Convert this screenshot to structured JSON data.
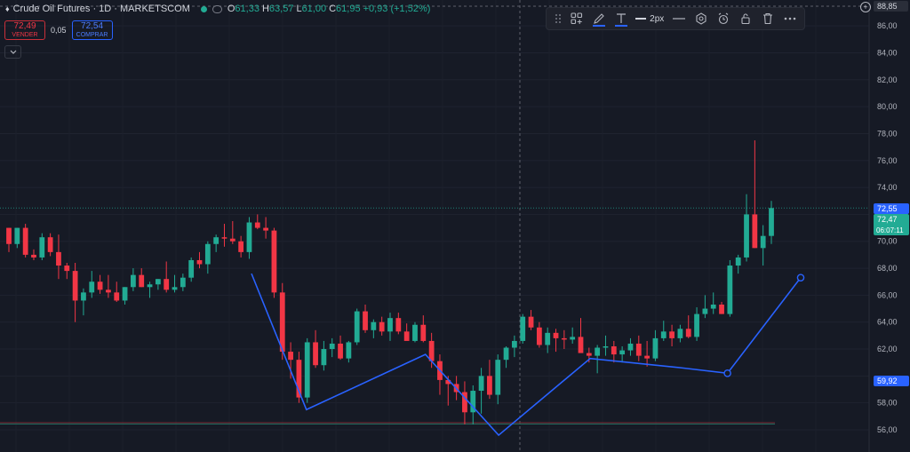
{
  "header": {
    "symbol": "Crude Oil Futures · 1D · MARKETSCOM",
    "ohlc": [
      {
        "label": "O",
        "value": "61,33"
      },
      {
        "label": "H",
        "value": "63,57"
      },
      {
        "label": "L",
        "value": "61,00"
      },
      {
        "label": "C",
        "value": "61,95"
      }
    ],
    "change": "+0,93 (+1,52%)"
  },
  "trade": {
    "sell_price": "72,49",
    "sell_label": "VENDER",
    "spread": "0,05",
    "buy_price": "72,54",
    "buy_label": "COMPRAR"
  },
  "collapse_icon": "chevron-down-icon",
  "toolbar": {
    "icons": [
      "drag-handle-icon",
      "template-icon",
      "pencil-icon",
      "text-icon",
      "line-width-icon",
      "line-style-icon",
      "settings-icon",
      "alert-clock-icon",
      "lock-icon",
      "trash-icon",
      "more-icon"
    ],
    "line_width_label": "2px",
    "accent": "#2962ff"
  },
  "price_axis": {
    "top_label": "88,85",
    "labels": [
      "86,00",
      "84,00",
      "82,00",
      "80,00",
      "78,00",
      "76,00",
      "74,00",
      "70,00",
      "68,00",
      "66,00",
      "64,00",
      "62,00",
      "58,00",
      "56,00"
    ],
    "badge_ask": "72,55",
    "badge_last": "72,47",
    "badge_countdown": "06:07:11",
    "badge_point": "59,92",
    "colors": {
      "up": "#22ab94",
      "down": "#f23645",
      "ask": "#2962ff",
      "line": "#2962ff"
    }
  },
  "chart_data": {
    "type": "candlestick",
    "y_range": [
      55.5,
      89.6
    ],
    "candles": [
      [
        71.0,
        71.0,
        69.2,
        69.8
      ],
      [
        69.8,
        71.0,
        69.5,
        71.0
      ],
      [
        71.0,
        71.3,
        68.8,
        69.0
      ],
      [
        69.0,
        69.4,
        68.6,
        68.8
      ],
      [
        68.8,
        70.6,
        68.6,
        70.3
      ],
      [
        70.3,
        70.6,
        68.9,
        69.2
      ],
      [
        69.2,
        70.5,
        67.2,
        68.2
      ],
      [
        68.2,
        68.4,
        67.2,
        67.8
      ],
      [
        67.8,
        68.4,
        64.0,
        65.6
      ],
      [
        65.6,
        66.5,
        64.5,
        66.2
      ],
      [
        66.2,
        67.8,
        65.8,
        67.0
      ],
      [
        67.0,
        67.5,
        66.1,
        66.4
      ],
      [
        66.4,
        67.5,
        65.8,
        66.2
      ],
      [
        66.2,
        67.0,
        65.5,
        65.6
      ],
      [
        65.6,
        66.6,
        65.3,
        66.6
      ],
      [
        66.6,
        68.0,
        66.3,
        67.5
      ],
      [
        67.5,
        68.0,
        66.6,
        66.6
      ],
      [
        66.6,
        67.0,
        65.8,
        66.8
      ],
      [
        66.8,
        67.2,
        66.4,
        67.2
      ],
      [
        67.2,
        68.5,
        66.2,
        66.4
      ],
      [
        66.4,
        67.5,
        66.2,
        66.6
      ],
      [
        66.6,
        67.6,
        66.3,
        67.3
      ],
      [
        67.3,
        68.8,
        67.0,
        68.6
      ],
      [
        68.6,
        69.2,
        68.0,
        68.3
      ],
      [
        68.3,
        70.0,
        67.6,
        69.8
      ],
      [
        69.8,
        70.5,
        69.2,
        70.3
      ],
      [
        70.3,
        71.3,
        69.6,
        70.2
      ],
      [
        70.2,
        71.5,
        69.8,
        70.0
      ],
      [
        70.0,
        70.4,
        68.8,
        69.2
      ],
      [
        69.2,
        71.8,
        68.7,
        71.4
      ],
      [
        71.4,
        72.0,
        70.9,
        71.0
      ],
      [
        71.0,
        71.8,
        70.2,
        70.8
      ],
      [
        70.8,
        71.0,
        65.8,
        66.2
      ],
      [
        66.2,
        66.9,
        61.2,
        61.8
      ],
      [
        61.8,
        62.5,
        59.8,
        61.2
      ],
      [
        61.2,
        61.8,
        58.0,
        58.4
      ],
      [
        58.4,
        62.8,
        58.0,
        62.5
      ],
      [
        62.5,
        63.4,
        60.6,
        60.8
      ],
      [
        60.8,
        62.6,
        60.4,
        62.0
      ],
      [
        62.0,
        62.8,
        61.4,
        62.4
      ],
      [
        62.4,
        63.0,
        61.2,
        61.3
      ],
      [
        61.3,
        62.6,
        61.0,
        62.5
      ],
      [
        62.5,
        65.0,
        62.3,
        64.8
      ],
      [
        64.8,
        65.3,
        63.2,
        63.4
      ],
      [
        63.4,
        64.2,
        62.8,
        64.0
      ],
      [
        64.0,
        64.4,
        63.0,
        63.3
      ],
      [
        63.3,
        64.7,
        62.6,
        64.3
      ],
      [
        64.3,
        64.7,
        63.1,
        63.3
      ],
      [
        63.3,
        63.9,
        62.7,
        62.6
      ],
      [
        62.6,
        64.0,
        62.5,
        63.8
      ],
      [
        63.8,
        64.5,
        62.5,
        62.6
      ],
      [
        62.6,
        63.2,
        60.6,
        61.1
      ],
      [
        61.1,
        61.6,
        58.6,
        59.7
      ],
      [
        59.7,
        60.0,
        57.8,
        59.4
      ],
      [
        59.4,
        60.0,
        58.2,
        58.8
      ],
      [
        58.8,
        59.6,
        56.4,
        57.3
      ],
      [
        57.3,
        59.3,
        56.4,
        58.9
      ],
      [
        58.9,
        60.6,
        57.2,
        60.0
      ],
      [
        60.0,
        61.2,
        58.3,
        58.6
      ],
      [
        58.6,
        61.6,
        57.9,
        61.2
      ],
      [
        61.2,
        62.2,
        60.6,
        62.1
      ],
      [
        62.1,
        63.0,
        61.4,
        62.6
      ],
      [
        62.6,
        64.6,
        62.4,
        64.4
      ],
      [
        64.4,
        64.9,
        63.4,
        63.6
      ],
      [
        63.6,
        64.0,
        62.1,
        62.3
      ],
      [
        62.3,
        63.6,
        61.7,
        63.2
      ],
      [
        63.2,
        63.5,
        61.8,
        62.8
      ],
      [
        62.8,
        63.4,
        62.0,
        62.7
      ],
      [
        62.7,
        63.6,
        62.4,
        62.9
      ],
      [
        62.9,
        64.3,
        62.0,
        61.7
      ],
      [
        61.7,
        62.1,
        61.0,
        61.5
      ],
      [
        61.5,
        62.3,
        60.2,
        62.1
      ],
      [
        62.1,
        63.0,
        61.5,
        62.2
      ],
      [
        62.2,
        62.6,
        61.0,
        61.6
      ],
      [
        61.6,
        62.2,
        61.0,
        61.9
      ],
      [
        61.9,
        62.8,
        61.5,
        62.4
      ],
      [
        62.4,
        63.0,
        61.1,
        61.5
      ],
      [
        61.5,
        62.6,
        60.7,
        61.3
      ],
      [
        61.3,
        63.4,
        61.1,
        62.8
      ],
      [
        62.8,
        64.1,
        62.6,
        63.3
      ],
      [
        63.3,
        63.8,
        62.2,
        62.8
      ],
      [
        62.8,
        63.8,
        62.5,
        63.5
      ],
      [
        63.5,
        64.5,
        62.8,
        62.9
      ],
      [
        62.9,
        65.1,
        62.6,
        64.6
      ],
      [
        64.6,
        66.0,
        64.3,
        65.0
      ],
      [
        65.0,
        66.2,
        64.6,
        65.3
      ],
      [
        65.3,
        65.5,
        64.6,
        64.6
      ],
      [
        64.6,
        68.6,
        64.4,
        68.2
      ],
      [
        68.2,
        69.0,
        67.6,
        68.8
      ],
      [
        68.8,
        73.5,
        68.5,
        72.0
      ],
      [
        72.0,
        77.5,
        69.5,
        69.5
      ],
      [
        69.5,
        71.2,
        68.2,
        70.4
      ],
      [
        70.4,
        73.0,
        69.8,
        72.47
      ]
    ],
    "drawing_polyline": [
      [
        35,
        67.6
      ],
      [
        41,
        57.5
      ],
      [
        54,
        61.6
      ],
      [
        62,
        55.6
      ],
      [
        72,
        61.3
      ],
      [
        82,
        60.6
      ],
      [
        87,
        60.2
      ],
      [
        95,
        67.3
      ]
    ],
    "x_range": [
      0,
      100
    ]
  }
}
